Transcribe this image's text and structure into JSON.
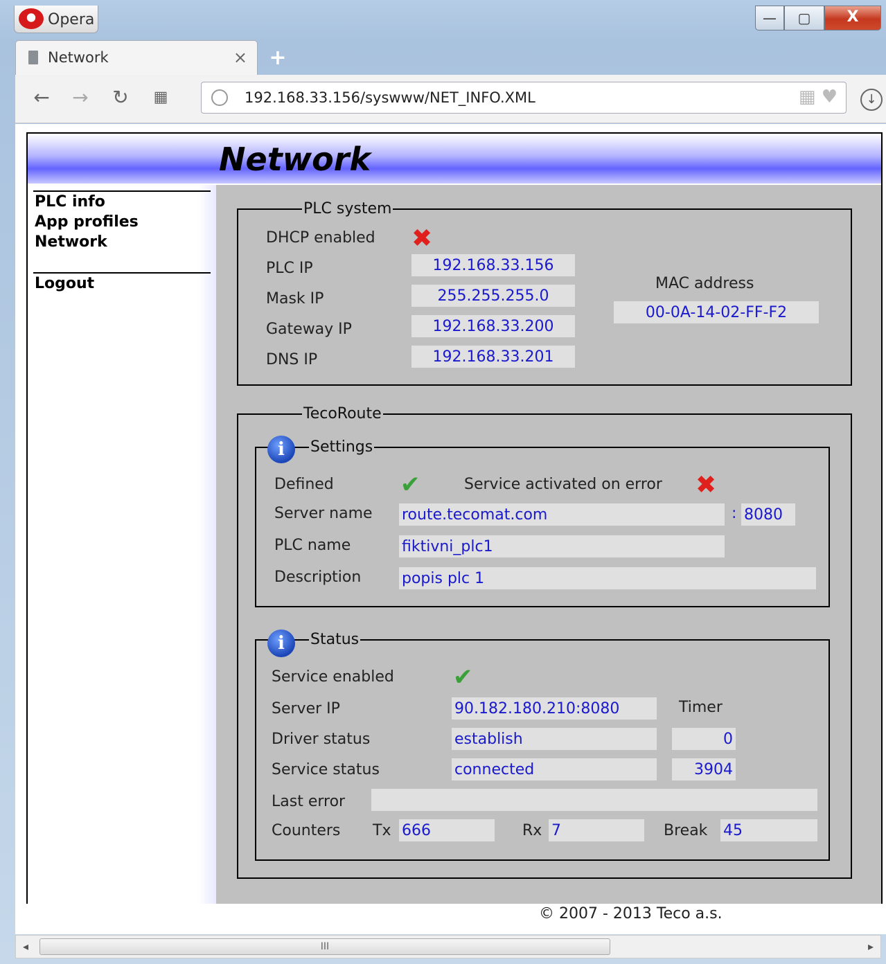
{
  "browser": {
    "app_name": "Opera",
    "tab_title": "Network",
    "url": "192.168.33.156/syswww/NET_INFO.XML",
    "window_controls": {
      "minimize": "—",
      "maximize": "▢",
      "close": "X"
    }
  },
  "page": {
    "title": "Network",
    "nav": [
      "PLC info",
      "App profiles",
      "Network"
    ],
    "logout": "Logout",
    "footer": "© 2007 - 2013 Teco a.s."
  },
  "plc_system": {
    "legend": "PLC system",
    "dhcp_label": "DHCP enabled",
    "dhcp_enabled": false,
    "plc_ip_label": "PLC IP",
    "plc_ip": "192.168.33.156",
    "mask_label": "Mask IP",
    "mask_ip": "255.255.255.0",
    "gateway_label": "Gateway IP",
    "gateway_ip": "192.168.33.200",
    "dns_label": "DNS IP",
    "dns_ip": "192.168.33.201",
    "mac_label": "MAC address",
    "mac": "00-0A-14-02-FF-F2"
  },
  "tecoroute": {
    "legend": "TecoRoute",
    "settings": {
      "legend": "Settings",
      "defined_label": "Defined",
      "defined": true,
      "activated_on_error_label": "Service activated on error",
      "activated_on_error": false,
      "server_name_label": "Server name",
      "server_name": "route.tecomat.com",
      "port_sep": ":",
      "port": "8080",
      "plc_name_label": "PLC name",
      "plc_name": "fiktivni_plc1",
      "description_label": "Description",
      "description": "popis plc 1"
    },
    "status": {
      "legend": "Status",
      "service_enabled_label": "Service enabled",
      "service_enabled": true,
      "server_ip_label": "Server IP",
      "server_ip": "90.182.180.210:8080",
      "timer_label": "Timer",
      "driver_status_label": "Driver status",
      "driver_status": "establish",
      "driver_timer": "0",
      "service_status_label": "Service status",
      "service_status": "connected",
      "service_timer": "3904",
      "last_error_label": "Last error",
      "last_error": "",
      "counters_label": "Counters",
      "tx_label": "Tx",
      "tx": "666",
      "rx_label": "Rx",
      "rx": "7",
      "break_label": "Break",
      "break": "45"
    }
  },
  "scrollbar": {
    "grip": "III"
  }
}
